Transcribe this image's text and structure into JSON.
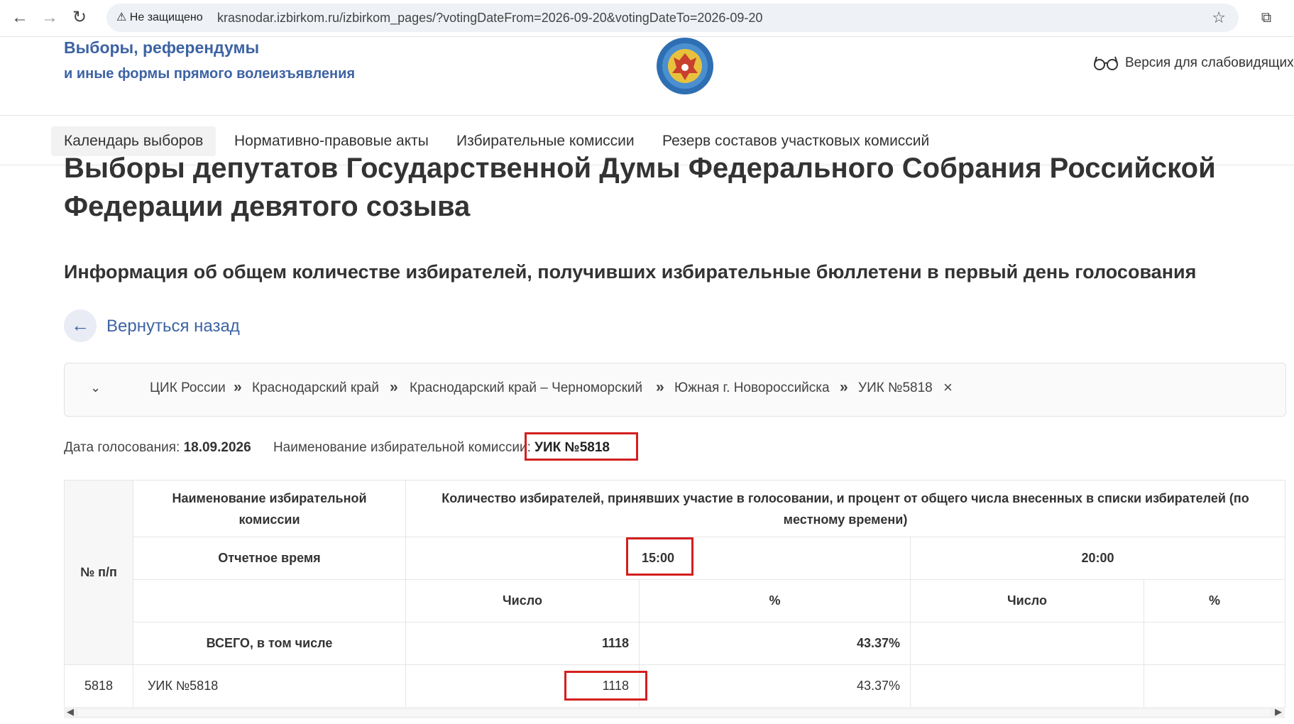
{
  "browser": {
    "security_label": "Не защищено",
    "url": "krasnodar.izbirkom.ru/izbirkom_pages/?votingDateFrom=2026-09-20&votingDateTo=2026-09-20"
  },
  "header": {
    "brand_line1": "Выборы, референдумы",
    "brand_line2": "и иные формы прямого волеизъявления",
    "accessibility_label": "Версия для слабовидящих"
  },
  "menu": {
    "items": [
      "Календарь выборов",
      "Нормативно-правовые акты",
      "Избирательные комиссии",
      "Резерв составов участковых комиссий"
    ],
    "active_index": 0
  },
  "page": {
    "title": "Выборы депутатов Государственной Думы Федерального Собрания Российской Федерации девятого созыва",
    "subtitle": "Информация об общем количестве избирателей, получивших избирательные бюллетени в первый день голосования",
    "back_label": "Вернуться назад"
  },
  "breadcrumb": {
    "items": [
      "ЦИК России",
      "Краснодарский край",
      "Краснодарский край – Черноморский",
      "Южная г. Новороссийска",
      "УИК №5818"
    ],
    "separator": "»",
    "close": "×"
  },
  "meta": {
    "date_label": "Дата голосования:",
    "date_value": "18.09.2026",
    "commission_label": "Наименование избирательной комиссии:",
    "commission_value": "УИК №5818"
  },
  "table": {
    "col_num": "№ п/п",
    "col_name": "Наименование избирательной комиссии",
    "col_group": "Количество избирателей, принявших участие в голосовании, и процент от общего числа внесенных в списки избирателей (по местному времени)",
    "report_time_label": "Отчетное время",
    "times": [
      "15:00",
      "20:00"
    ],
    "sub_count": "Число",
    "sub_pct": "%",
    "total_row": {
      "label": "ВСЕГО, в том числе",
      "count_1500": "1118",
      "pct_1500": "43.37%",
      "count_2000": "",
      "pct_2000": ""
    },
    "rows": [
      {
        "num": "5818",
        "name": "УИК №5818",
        "count_1500": "1118",
        "pct_1500": "43.37%",
        "count_2000": "",
        "pct_2000": ""
      }
    ]
  },
  "colors": {
    "accent": "#3d63a3",
    "highlight": "#d31f1f"
  }
}
